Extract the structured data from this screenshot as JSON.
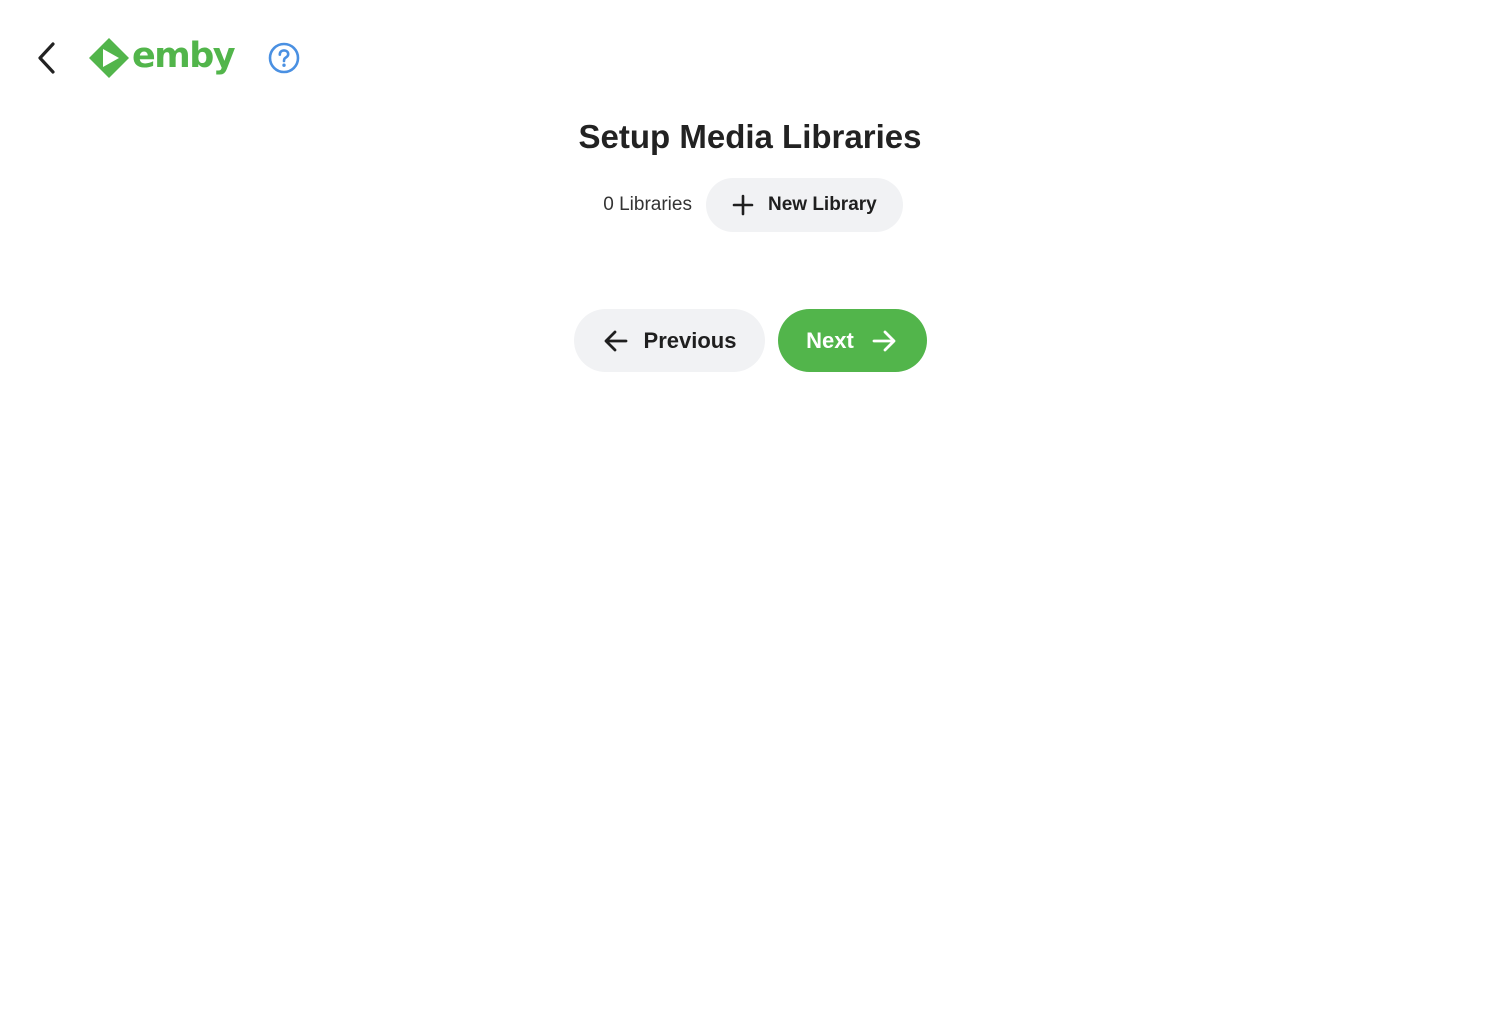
{
  "header": {
    "back_icon": "chevron-left-icon",
    "logo_text": "emby",
    "help_icon": "help-circle-icon"
  },
  "main": {
    "title": "Setup Media Libraries",
    "library_count": "0 Libraries",
    "new_library_label": "New Library",
    "new_library_icon": "plus-icon"
  },
  "navigation": {
    "previous_label": "Previous",
    "previous_icon": "arrow-left-icon",
    "next_label": "Next",
    "next_icon": "arrow-right-icon"
  },
  "colors": {
    "brand_green": "#52b54b",
    "help_blue": "#4a90e2",
    "button_gray": "#f1f2f4"
  }
}
